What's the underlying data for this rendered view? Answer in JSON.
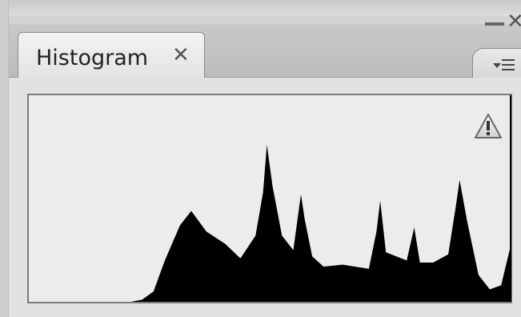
{
  "panel": {
    "tab_label": "Histogram",
    "tab_close_glyph": "✕",
    "window_close_glyph": "✕"
  },
  "icons": {
    "warning": "warning-triangle-icon",
    "menu": "panel-menu-icon",
    "minimize": "minimize-icon",
    "close": "close-icon"
  },
  "colors": {
    "histogram_fill": "#000000",
    "frame_bg": "#ececec",
    "panel_bg": "#d4d4d4"
  },
  "chart_data": {
    "type": "area",
    "title": "",
    "xlabel": "",
    "ylabel": "",
    "xlim": [
      0,
      255
    ],
    "ylim": [
      0,
      1
    ],
    "grid": false,
    "series": [
      {
        "values": [
          [
            0,
            0
          ],
          [
            54,
            0
          ],
          [
            60,
            0.01
          ],
          [
            66,
            0.05
          ],
          [
            72,
            0.2
          ],
          [
            80,
            0.37
          ],
          [
            86,
            0.44
          ],
          [
            94,
            0.34
          ],
          [
            104,
            0.28
          ],
          [
            112,
            0.21
          ],
          [
            120,
            0.32
          ],
          [
            124,
            0.53
          ],
          [
            126,
            0.76
          ],
          [
            129,
            0.56
          ],
          [
            134,
            0.32
          ],
          [
            140,
            0.25
          ],
          [
            144,
            0.52
          ],
          [
            146,
            0.4
          ],
          [
            150,
            0.22
          ],
          [
            156,
            0.17
          ],
          [
            166,
            0.18
          ],
          [
            180,
            0.16
          ],
          [
            184,
            0.34
          ],
          [
            186,
            0.49
          ],
          [
            189,
            0.24
          ],
          [
            200,
            0.2
          ],
          [
            204,
            0.36
          ],
          [
            207,
            0.19
          ],
          [
            214,
            0.19
          ],
          [
            222,
            0.23
          ],
          [
            226,
            0.46
          ],
          [
            228,
            0.59
          ],
          [
            232,
            0.39
          ],
          [
            238,
            0.13
          ],
          [
            244,
            0.06
          ],
          [
            250,
            0.08
          ],
          [
            255,
            0.27
          ]
        ]
      }
    ]
  }
}
